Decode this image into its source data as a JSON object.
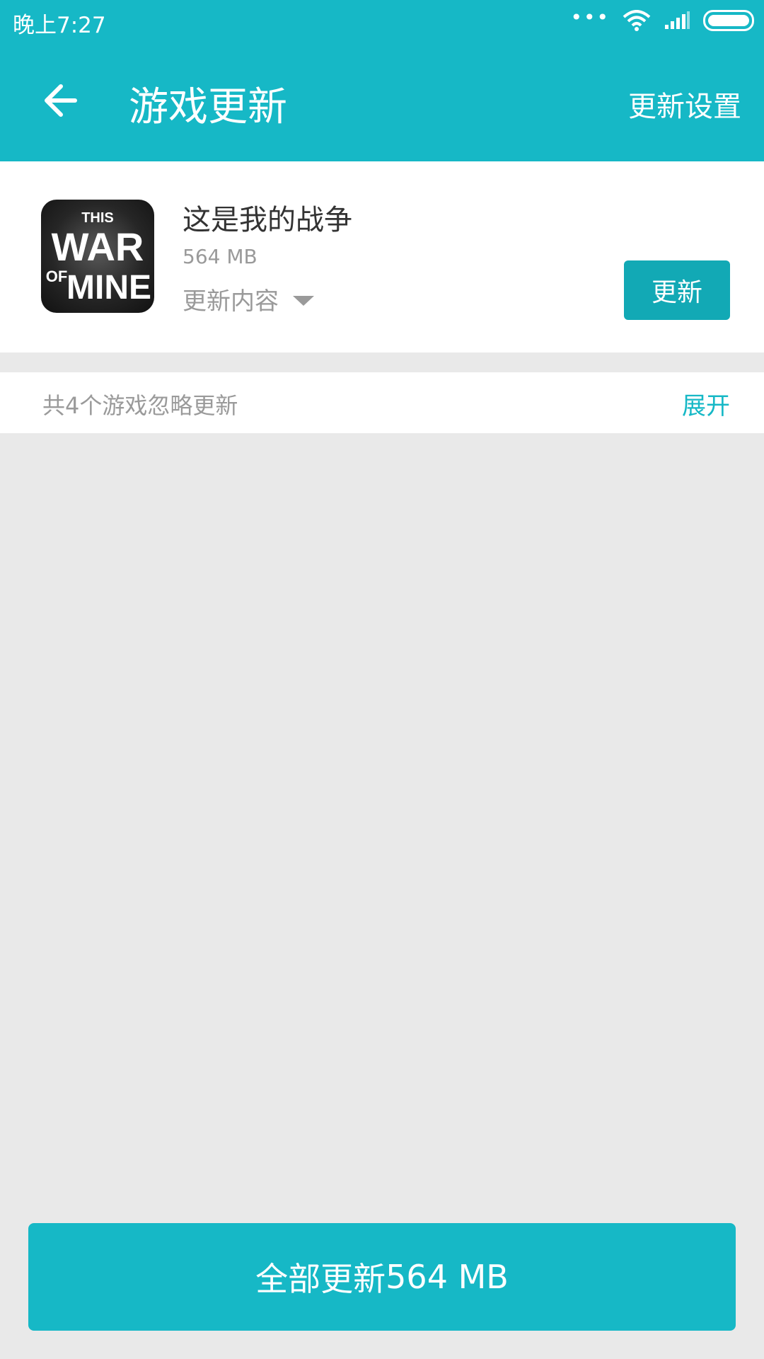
{
  "status_bar": {
    "time": "晚上7:27",
    "more_dots": "•••"
  },
  "app_bar": {
    "title": "游戏更新",
    "settings_label": "更新设置"
  },
  "update_item": {
    "name": "这是我的战争",
    "size": "564 MB",
    "content_label": "更新内容",
    "update_label": "更新",
    "icon_text": {
      "line1": "THIS",
      "line2": "WAR",
      "line3a": "OF",
      "line3b": "MINE"
    }
  },
  "ignored": {
    "text": "共4个游戏忽略更新",
    "expand_label": "展开"
  },
  "update_all": {
    "label": "全部更新",
    "size": "564 MB"
  },
  "colors": {
    "primary": "#16b8c6",
    "button": "#12a9b5",
    "background": "#e9e9e9"
  }
}
